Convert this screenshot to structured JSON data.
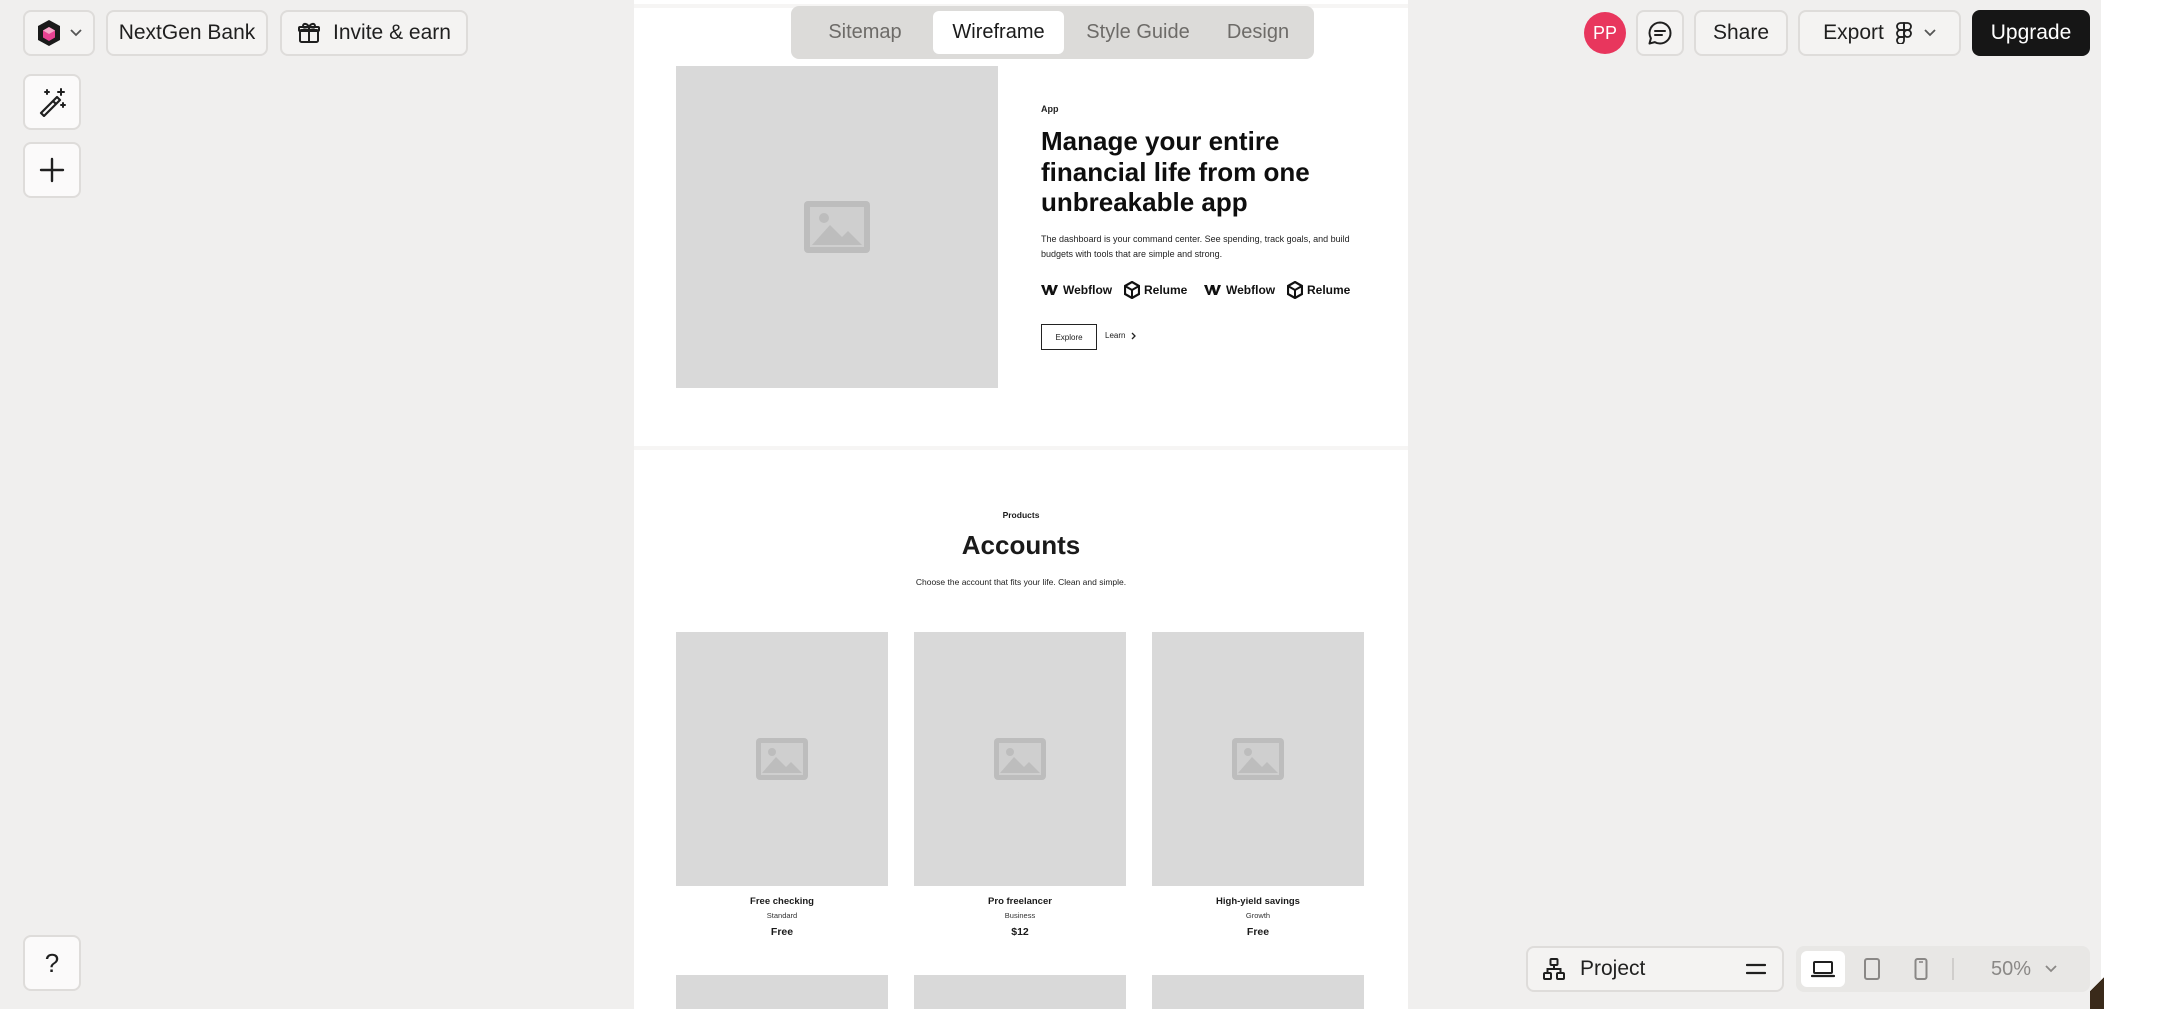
{
  "topbar": {
    "project_name": "NextGen Bank",
    "invite_label": "Invite & earn",
    "avatar_initials": "PP",
    "share_label": "Share",
    "export_label": "Export",
    "upgrade_label": "Upgrade"
  },
  "tabs": [
    {
      "label": "Sitemap",
      "active": false
    },
    {
      "label": "Wireframe",
      "active": true
    },
    {
      "label": "Style Guide",
      "active": false
    },
    {
      "label": "Design",
      "active": false
    }
  ],
  "left_toolbar": {
    "tools": [
      "magic-wand-icon",
      "plus-icon"
    ],
    "help_label": "?"
  },
  "wireframe": {
    "hero": {
      "eyebrow": "App",
      "title": "Manage your entire financial life from one unbreakable app",
      "description": "The dashboard is your command center. See spending, track goals, and build budgets with tools that are simple and strong.",
      "logos": [
        "Webflow",
        "Relume",
        "Webflow",
        "Relume"
      ],
      "primary_button": "Explore",
      "secondary_link": "Learn"
    },
    "accounts": {
      "eyebrow": "Products",
      "title": "Accounts",
      "description": "Choose the account that fits your life. Clean and simple.",
      "cards": [
        {
          "name": "Free checking",
          "tier": "Standard",
          "price": "Free"
        },
        {
          "name": "Pro freelancer",
          "tier": "Business",
          "price": "$12"
        },
        {
          "name": "High-yield savings",
          "tier": "Growth",
          "price": "Free"
        }
      ]
    }
  },
  "bottom_bar": {
    "project_label": "Project",
    "zoom": "50%",
    "views": [
      "desktop",
      "tablet",
      "mobile"
    ],
    "active_view": "desktop"
  },
  "colors": {
    "background": "#f0efee",
    "avatar": "#e8365d",
    "upgrade_button": "#161616",
    "placeholder": "#d9d9d9"
  }
}
